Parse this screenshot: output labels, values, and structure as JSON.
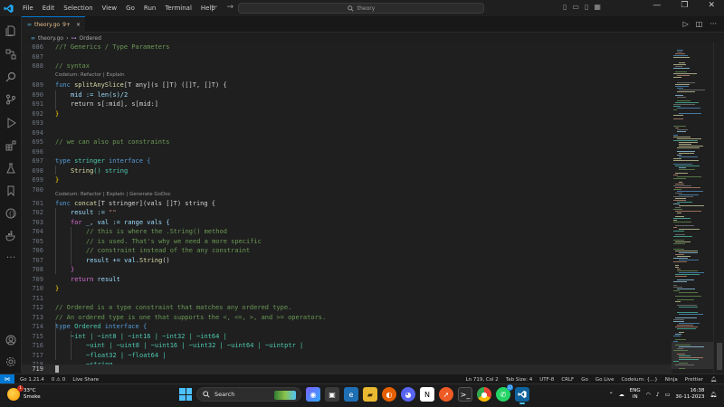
{
  "titlebar": {
    "menu": [
      "File",
      "Edit",
      "Selection",
      "View",
      "Go",
      "Run",
      "Terminal",
      "Help"
    ],
    "search_text": "theory"
  },
  "tab": {
    "name": "theory.go",
    "badge": "9+"
  },
  "breadcrumb": {
    "file": "theory.go",
    "symbol": "Ordered"
  },
  "codelens": {
    "c1": "Codeium: Refactor | Explain",
    "c2": "Codeium: Refactor | Explain | Generate GoDoc"
  },
  "line_numbers": {
    "l686": "686",
    "l687": "687",
    "l688": "688",
    "l689": "689",
    "l690": "690",
    "l691": "691",
    "l692": "692",
    "l693": "693",
    "l694": "694",
    "l695": "695",
    "l696": "696",
    "l697": "697",
    "l698": "698",
    "l699": "699",
    "l700": "700",
    "l701": "701",
    "l702": "702",
    "l703": "703",
    "l704": "704",
    "l705": "705",
    "l706": "706",
    "l707": "707",
    "l708": "708",
    "l709": "709",
    "l710": "710",
    "l711": "711",
    "l712": "712",
    "l713": "713",
    "l714": "714",
    "l715": "715",
    "l716": "716",
    "l717": "717",
    "l718": "718",
    "l719": "719"
  },
  "code": {
    "l686": "//? Generics / Type Parameters",
    "l688": "// syntax",
    "l689_func": "func ",
    "l689_name": "splitAnySlice",
    "l689_rest": "[T any](s []T) ([]T, []T) {",
    "l690": "mid := len(s)/2",
    "l691": "return s[:mid], s[mid:]",
    "l692": "}",
    "l695": "// we can also put constraints",
    "l697_kw": "type ",
    "l697_name": "stringer",
    "l697_rest": " interface {",
    "l698_fn": "String",
    "l698_rest": "() string",
    "l699": "}",
    "l701_func": "func ",
    "l701_name": "concat",
    "l701_rest": "[T stringer](vals []T) string {",
    "l702_a": "result := ",
    "l702_b": "\"\"",
    "l703_a": "for ",
    "l703_b": "_, val := range vals {",
    "l704": "// this is where the .String() method",
    "l705": "// is used. That's why we need a more specific",
    "l706": "// constraint instead of the any constraint",
    "l707_a": "result += val.",
    "l707_b": "String",
    "l707_c": "()",
    "l708": "}",
    "l709_a": "return ",
    "l709_b": "result",
    "l710": "}",
    "l712": "// Ordered is a type constraint that matches any ordered type.",
    "l713": "// An ordered type is one that supports the <, <=, >, and >= operators.",
    "l714_kw": "type ",
    "l714_name": "Ordered",
    "l714_rest": " interface {",
    "l715": "~int | ~int8 | ~int16 | ~int32 | ~int64 |",
    "l716": "~uint | ~uint8 | ~uint16 | ~uint32 | ~uint64 | ~uintptr |",
    "l717": "~float32 | ~float64 |",
    "l718": "~string"
  },
  "statusbar": {
    "left": [
      "Go 1.21.4",
      "0 ⚠ 0",
      "Live Share"
    ],
    "right": [
      "Ln 719, Col 2",
      "Tab Size: 4",
      "UTF-8",
      "CRLF",
      "Go",
      "Go Live",
      "Codeium: {...}",
      "Ninja",
      "Prettier"
    ]
  },
  "taskbar": {
    "temp": "33°C",
    "condition": "Smoke",
    "weather_badge": "1",
    "search_label": "Search",
    "lang_top": "ENG",
    "lang_bottom": "IN",
    "time": "16:38",
    "date": "30-11-2023",
    "app_badge": "17"
  },
  "colors": {
    "accent": "#0078d4",
    "editor_bg": "#1f1f1f"
  }
}
